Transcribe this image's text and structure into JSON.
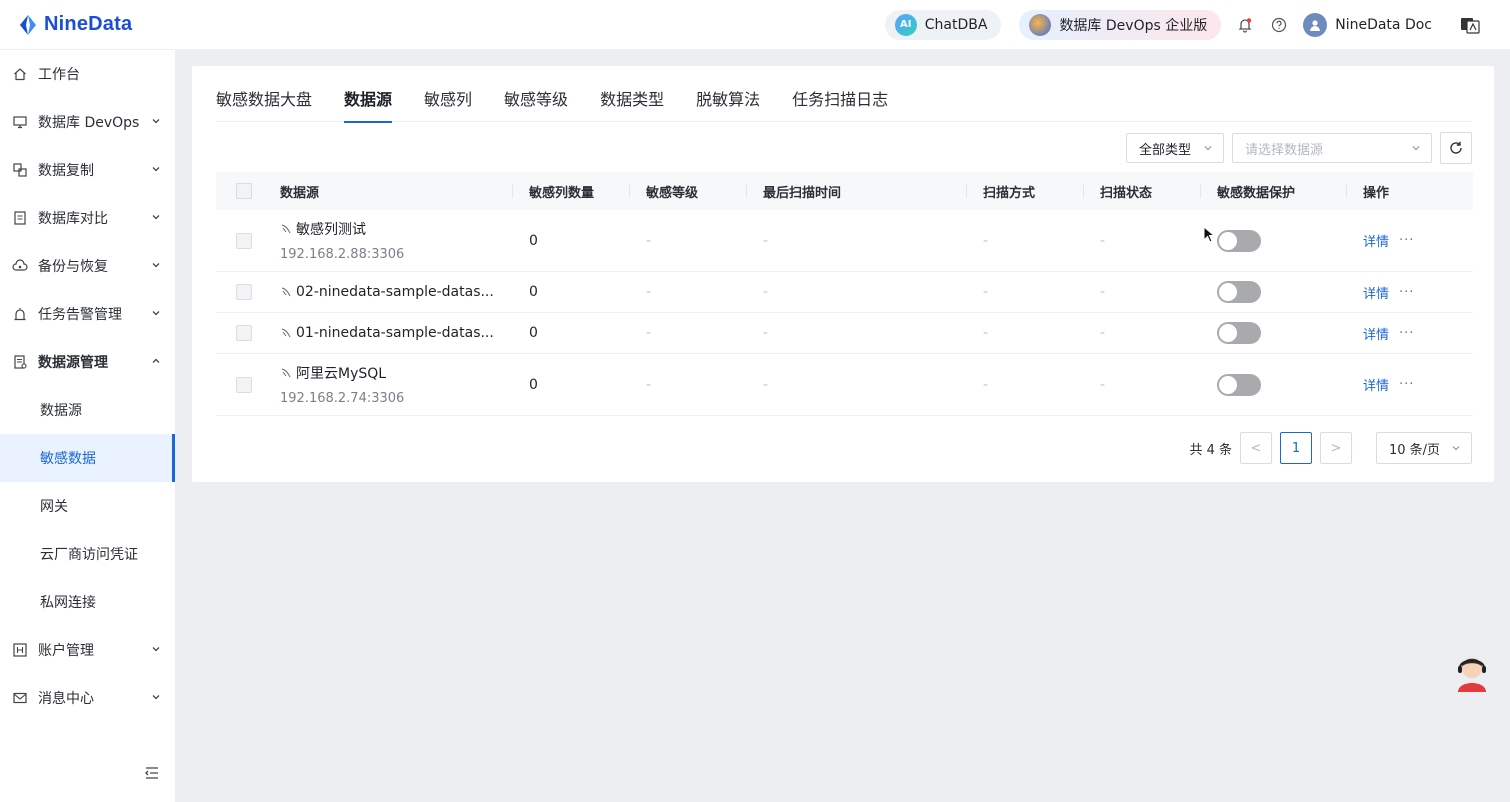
{
  "brand": {
    "name": "NineData"
  },
  "topbar": {
    "chat_label": "ChatDBA",
    "chat_badge": "AI",
    "devops_label": "数据库 DevOps 企业版",
    "user_name": "NineData Doc",
    "colors": {
      "brand_blue": "#1a4ed8",
      "accent": "#1a67d8"
    }
  },
  "sidebar": {
    "items": [
      {
        "label": "工作台",
        "icon": "home-icon"
      },
      {
        "label": "数据库 DevOps",
        "icon": "monitor-icon"
      },
      {
        "label": "数据复制",
        "icon": "copy-icon"
      },
      {
        "label": "数据库对比",
        "icon": "compare-icon"
      },
      {
        "label": "备份与恢复",
        "icon": "cloud-backup-icon"
      },
      {
        "label": "任务告警管理",
        "icon": "alarm-icon"
      },
      {
        "label": "数据源管理",
        "icon": "datasource-icon"
      }
    ],
    "sub_items": [
      {
        "label": "数据源"
      },
      {
        "label": "敏感数据"
      },
      {
        "label": "网关"
      },
      {
        "label": "云厂商访问凭证"
      },
      {
        "label": "私网连接"
      }
    ],
    "bottom_items": [
      {
        "label": "账户管理",
        "icon": "account-icon"
      },
      {
        "label": "消息中心",
        "icon": "mail-icon"
      }
    ]
  },
  "tabs": [
    {
      "label": "敏感数据大盘"
    },
    {
      "label": "数据源"
    },
    {
      "label": "敏感列"
    },
    {
      "label": "敏感等级"
    },
    {
      "label": "数据类型"
    },
    {
      "label": "脱敏算法"
    },
    {
      "label": "任务扫描日志"
    }
  ],
  "filters": {
    "type_value": "全部类型",
    "source_placeholder": "请选择数据源"
  },
  "table": {
    "headers": [
      "数据源",
      "敏感列数量",
      "敏感等级",
      "最后扫描时间",
      "扫描方式",
      "扫描状态",
      "敏感数据保护",
      "操作"
    ],
    "rows": [
      {
        "name": "敏感列测试",
        "address": "192.168.2.88:3306",
        "count": "0",
        "level": "-",
        "last_scan": "-",
        "method": "-",
        "status": "-",
        "action": "详情",
        "more": "···"
      },
      {
        "name": "02-ninedata-sample-datas...",
        "address": "",
        "count": "0",
        "level": "-",
        "last_scan": "-",
        "method": "-",
        "status": "-",
        "action": "详情",
        "more": "···"
      },
      {
        "name": "01-ninedata-sample-datas...",
        "address": "",
        "count": "0",
        "level": "-",
        "last_scan": "-",
        "method": "-",
        "status": "-",
        "action": "详情",
        "more": "···"
      },
      {
        "name": "阿里云MySQL",
        "address": "192.168.2.74:3306",
        "count": "0",
        "level": "-",
        "last_scan": "-",
        "method": "-",
        "status": "-",
        "action": "详情",
        "more": "···"
      }
    ]
  },
  "pagination": {
    "total": "共 4 条",
    "current_page": "1",
    "page_size": "10 条/页",
    "prev": "<",
    "next": ">"
  }
}
